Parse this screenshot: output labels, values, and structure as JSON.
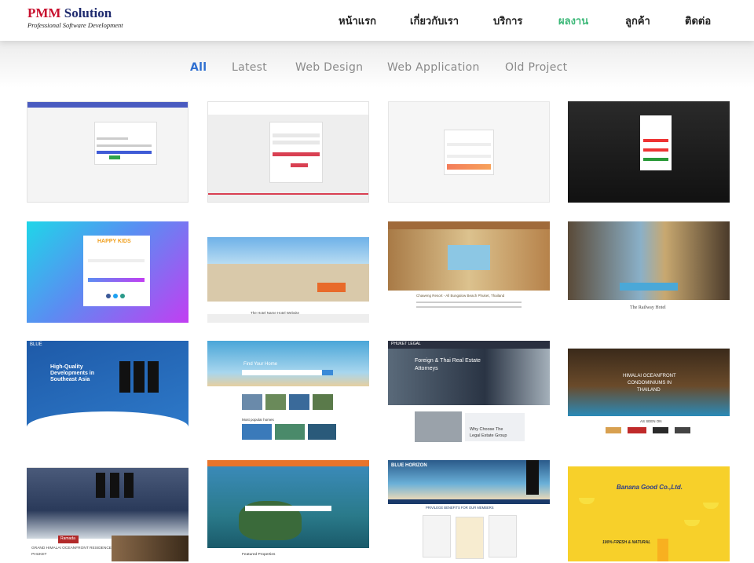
{
  "brand": {
    "name_part1": "PMM",
    "name_part2": "Solution",
    "tagline": "Professional Software Development"
  },
  "nav": {
    "items": [
      {
        "label": "หน้าแรก",
        "active": false
      },
      {
        "label": "เกี่ยวกับเรา",
        "active": false
      },
      {
        "label": "บริการ",
        "active": false
      },
      {
        "label": "ผลงาน",
        "active": true
      },
      {
        "label": "ลูกค้า",
        "active": false
      },
      {
        "label": "ติดต่อ",
        "active": false
      }
    ],
    "active_color": "#3cb878"
  },
  "filters": {
    "items": [
      "All",
      "Latest",
      "Web Design",
      "Web Application",
      "Old Project"
    ],
    "selected": "All",
    "selected_color": "#2f6fd0"
  },
  "portfolio": {
    "t5": {
      "logo_text": "HAPPY KIDS"
    },
    "t6": {
      "caption": "The Hotel Name Hotel Website"
    },
    "t7": {
      "caption": "Chaweng Resort - All Bungalow Beach Phuket, Thailand"
    },
    "t8": {
      "caption": "The Railway Hotel"
    },
    "t9": {
      "logo": "BLUE",
      "headline_1": "High-Quality",
      "headline_2": "Developments in",
      "headline_3": "Southeast Asia"
    },
    "t10": {
      "headline": "Find Your Home",
      "section": "Most popular homes"
    },
    "t11": {
      "logo": "PHUKET LEGAL",
      "headline_1": "Foreign & Thai Real Estate",
      "headline_2": "Attorneys",
      "subhead_1": "Why Choose The",
      "subhead_2": "Legal Estate Group"
    },
    "t12": {
      "headline_1": "HIMALAI OCEANFRONT",
      "headline_2": "CONDOMINIUMS IN",
      "headline_3": "THAILAND",
      "as_seen": "AS SEEN ON"
    },
    "t13": {
      "badge": "Ramada",
      "caption_1": "GRAND HIMALAI OCEANFRONT RESIDENCES",
      "caption_2": "PHUKET"
    },
    "t14": {
      "section": "Featured Properties"
    },
    "t15": {
      "logo": "BLUE HORIZON",
      "section": "PRIVILEGE BENEFITS FOR OUR MEMBERS"
    },
    "t16": {
      "title": "Banana Good Co.,Ltd.",
      "tagline": "100% FRESH & NATURAL"
    }
  }
}
